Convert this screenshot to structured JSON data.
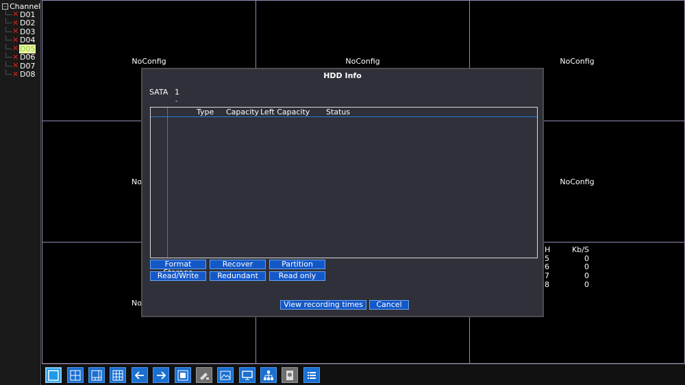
{
  "channel_tree": {
    "root_label": "Channel",
    "items": [
      "D01",
      "D02",
      "D03",
      "D04",
      "D05",
      "D06",
      "D07",
      "D08"
    ],
    "selected": "D05"
  },
  "grid": {
    "no_config_label": "NoConfig"
  },
  "stats": {
    "header_ch": "H",
    "header_kbs": "Kb/S",
    "rows": [
      {
        "ch": "5",
        "kbs": "0"
      },
      {
        "ch": "6",
        "kbs": "0"
      },
      {
        "ch": "7",
        "kbs": "0"
      },
      {
        "ch": "8",
        "kbs": "0"
      }
    ]
  },
  "dialog": {
    "title": "HDD Info",
    "sata_label": "SATA",
    "sata_value": "1",
    "sata_sub": "-",
    "columns": [
      "Type",
      "Capacity",
      "Left Capacity",
      "Status"
    ],
    "buttons": {
      "format_storage": "Format Storage",
      "recover": "Recover",
      "partition": "Partition",
      "read_write": "Read/Write",
      "redundant": "Redundant",
      "read_only": "Read only",
      "view_recording_times": "View recording times",
      "cancel": "Cancel"
    }
  },
  "toolbar": {
    "icons": [
      "single-view-icon",
      "quad-view-icon",
      "six-view-icon",
      "nine-view-icon",
      "previous-icon",
      "next-icon",
      "fullscreen-icon",
      "ptz-icon",
      "image-color-icon",
      "output-adjust-icon",
      "network-icon",
      "hdd-icon",
      "main-menu-icon"
    ]
  }
}
